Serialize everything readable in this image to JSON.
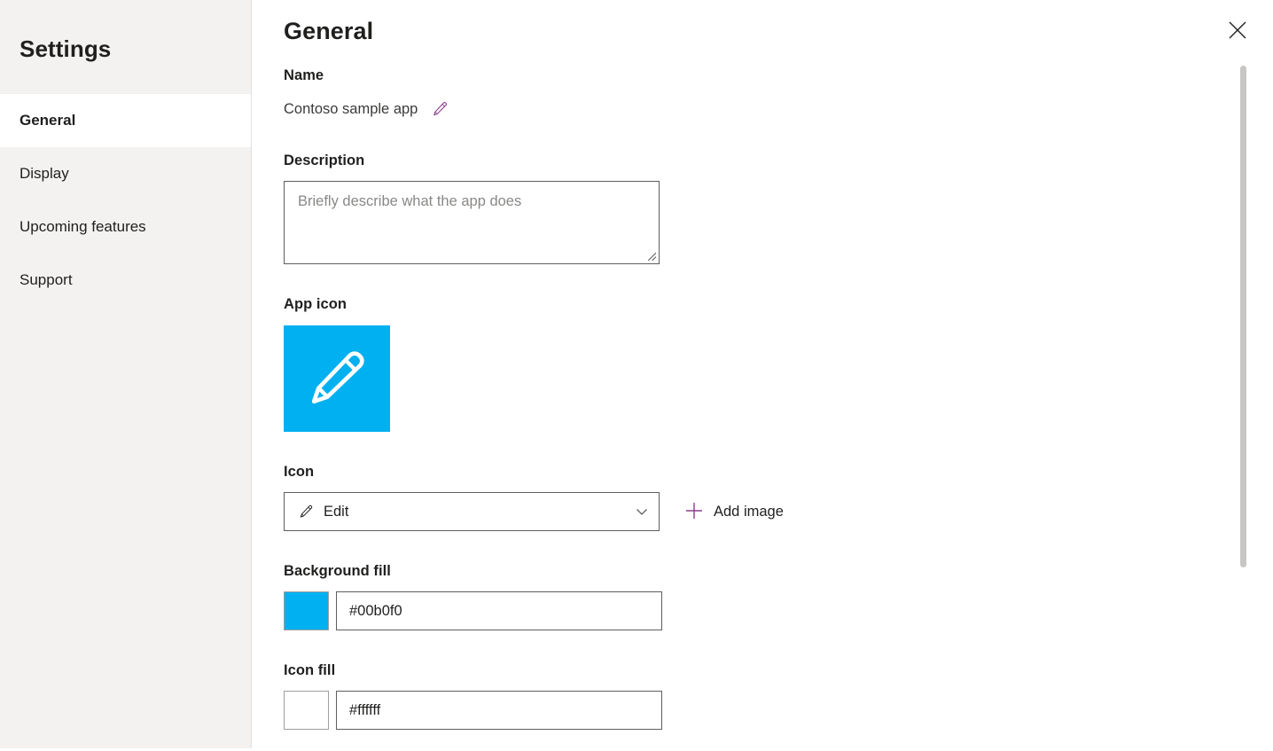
{
  "sidebar": {
    "title": "Settings",
    "items": [
      {
        "label": "General",
        "selected": true
      },
      {
        "label": "Display",
        "selected": false
      },
      {
        "label": "Upcoming features",
        "selected": false
      },
      {
        "label": "Support",
        "selected": false
      }
    ]
  },
  "header": {
    "title": "General",
    "close_icon": "close-icon"
  },
  "form": {
    "name": {
      "label": "Name",
      "value": "Contoso sample app",
      "edit_icon": "pencil-icon"
    },
    "description": {
      "label": "Description",
      "value": "",
      "placeholder": "Briefly describe what the app does"
    },
    "app_icon": {
      "label": "App icon",
      "glyph": "pencil-icon",
      "background": "#00b0f0",
      "foreground": "#ffffff"
    },
    "icon_select": {
      "label": "Icon",
      "value": "Edit",
      "leading_icon": "pencil-icon",
      "chevron_icon": "chevron-down-icon",
      "options": [
        "Edit"
      ]
    },
    "add_image": {
      "label": "Add image",
      "icon": "plus-icon"
    },
    "background_fill": {
      "label": "Background fill",
      "value": "#00b0f0",
      "swatch": "#00b0f0"
    },
    "icon_fill": {
      "label": "Icon fill",
      "value": "#ffffff",
      "swatch": "#ffffff"
    }
  },
  "colors": {
    "accent_purple": "#8a3f8e",
    "sidebar_bg": "#f3f2f1",
    "panel_bg": "#ffffff",
    "text": "#201f1e",
    "border": "#605e5c",
    "scrollbar": "#c8c6c4"
  },
  "scrollbar": {
    "name": "vertical-scrollbar"
  }
}
